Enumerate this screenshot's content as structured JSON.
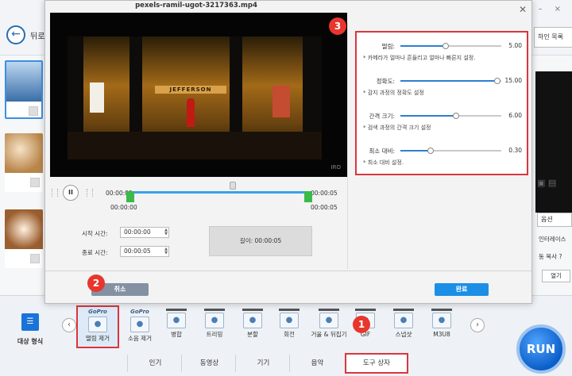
{
  "app": {
    "back_label": "뒤로",
    "top_right_label": "하인 목록",
    "right_option_label": "옵션",
    "right_interlace": "인터레이스",
    "right_copy": "동 복사 ?",
    "right_open": "열기",
    "format_label": "대상 형식",
    "run_label": "RUN"
  },
  "dialog": {
    "title": "pexels-ramil-ugot-3217363.mp4",
    "video_sign_text": "JEFFERSON",
    "video_overlay_code": "IRO",
    "current_time": "00:00:03",
    "end_time": "00:00:05",
    "start_mark": "00:00:00",
    "end_mark": "00:00:05",
    "start_label": "시작 시간:",
    "start_value": "00:00:00",
    "end_label": "종료 시간:",
    "end_value": "00:00:05",
    "length_label": "길이: 00:00:05",
    "cancel_label": "취소",
    "ok_label": "완료",
    "settings": [
      {
        "name": "떨림:",
        "value": "5.00",
        "fraction": 0.45,
        "desc": "* 카메라가 얼마나 흔들리고 얼마나 빠른지 설정."
      },
      {
        "name": "정확도:",
        "value": "15.00",
        "fraction": 0.96,
        "desc": "* 감지 과정의 정확도 설정"
      },
      {
        "name": "간격 크기:",
        "value": "6.00",
        "fraction": 0.55,
        "desc": "* 검색 과정의 간격 크기 설정"
      },
      {
        "name": "최소 대비:",
        "value": "0.30",
        "fraction": 0.3,
        "desc": "* 최소 대비 설정."
      }
    ]
  },
  "tools": [
    {
      "label": "떨림 제거",
      "badge": "GoPro",
      "icon": "stabilize-icon",
      "selected": true
    },
    {
      "label": "소음 제거",
      "badge": "GoPro",
      "icon": "denoise-icon",
      "selected": false
    },
    {
      "label": "병합",
      "badge": "",
      "icon": "merge-icon",
      "selected": false
    },
    {
      "label": "트리밍",
      "badge": "",
      "icon": "trim-icon",
      "selected": false
    },
    {
      "label": "분할",
      "badge": "",
      "icon": "split-icon",
      "selected": false
    },
    {
      "label": "회전",
      "badge": "",
      "icon": "rotate-icon",
      "selected": false
    },
    {
      "label": "거울 & 뒤집기",
      "badge": "",
      "icon": "mirror-icon",
      "selected": false
    },
    {
      "label": "GIF",
      "badge": "",
      "icon": "gif-icon",
      "selected": false
    },
    {
      "label": "스냅샷",
      "badge": "",
      "icon": "snapshot-icon",
      "selected": false
    },
    {
      "label": "M3U8",
      "badge": "",
      "icon": "m3u8-icon",
      "selected": false
    }
  ],
  "tabs": [
    {
      "label": "인기",
      "active": false
    },
    {
      "label": "동영상",
      "active": false
    },
    {
      "label": "기기",
      "active": false
    },
    {
      "label": "음악",
      "active": false
    },
    {
      "label": "도구 상자",
      "active": true
    }
  ],
  "callouts": [
    "1",
    "2",
    "3"
  ]
}
